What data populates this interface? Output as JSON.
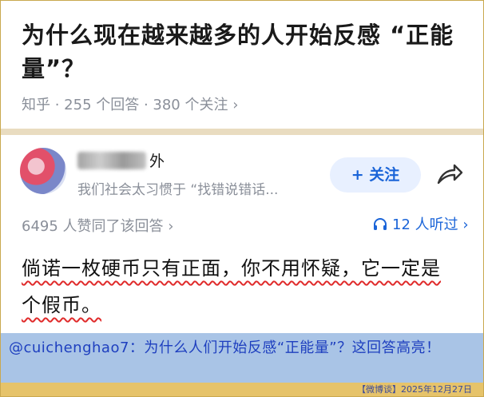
{
  "question": {
    "title": "为什么现在越来越多的人开始反感 “正能量”？",
    "meta": "知乎 · 255 个回答 · 380 个关注 ›"
  },
  "answer": {
    "author_name": "外",
    "author_bio": "我们社会太习惯于 “找错说错话...",
    "follow_label": "+ 关注",
    "agree_text": "6495 人赞同了该回答 ›",
    "listen_text": "12 人听过 ›",
    "body_line1": "倘诺一枚硬币只有正面，你不用怀疑，它一定是",
    "body_line2": "个假币。"
  },
  "caption": {
    "text": "@cuichenghao7：为什么人们开始反感“正能量”？这回答高亮！"
  },
  "source": {
    "text": "【微博谈】2025年12月27日"
  },
  "colors": {
    "accent_blue": "#1a64d8",
    "caption_bg": "#a9c4e6",
    "source_bg": "#e6c36a",
    "underline_red": "#e02b2b"
  },
  "icons": {
    "share": "share-icon",
    "headphone": "headphone-icon",
    "avatar": "avatar"
  }
}
